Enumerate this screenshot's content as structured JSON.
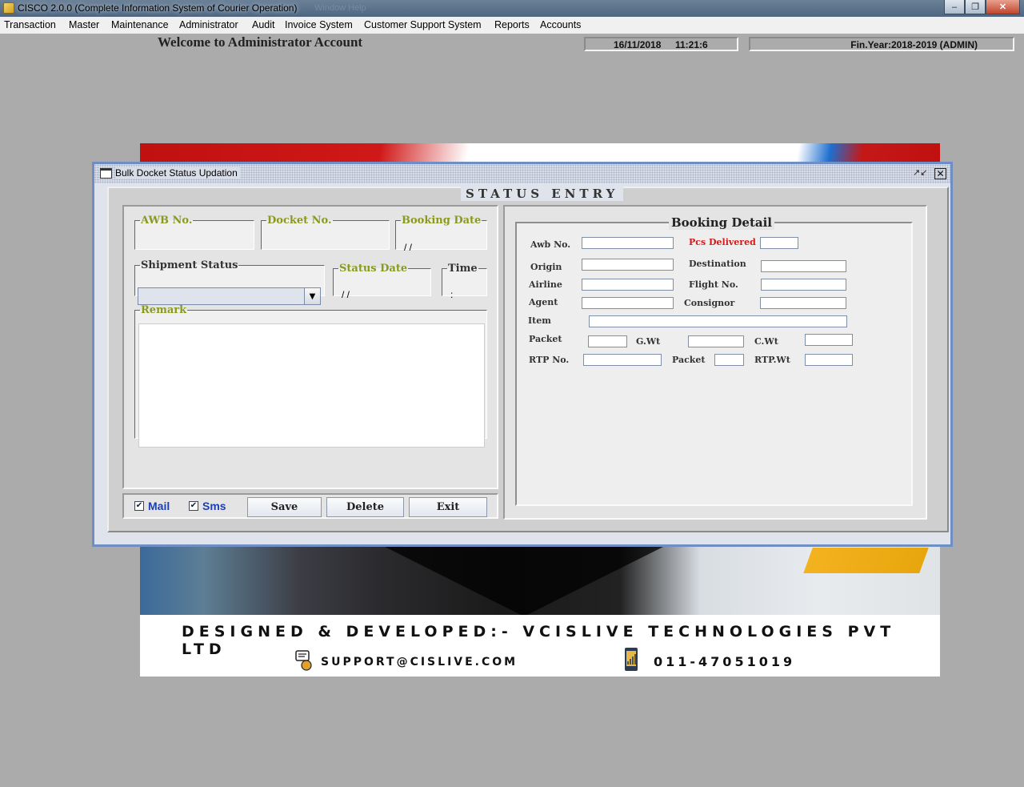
{
  "app": {
    "title": "CISCO 2.0.0 (Complete Information System of Courier Operation)",
    "ghost_menu": "Window    Help"
  },
  "menu": [
    "Transaction",
    "Master",
    "Maintenance",
    "Administrator",
    "Audit",
    "Invoice System",
    "Customer Support System",
    "Reports",
    "Accounts"
  ],
  "header": {
    "welcome": "Welcome to Administrator Account",
    "date": "16/11/2018",
    "time": "11:21:6",
    "fin_year": "Fin.Year:2018-2019  (ADMIN)"
  },
  "banner": {
    "developed_by": "DESIGNED & DEVELOPED:- VCISLIVE TECHNOLOGIES PVT LTD",
    "email": "SUPPORT@CISLIVE.COM",
    "phone": "011-47051019"
  },
  "dialog": {
    "title": "Bulk Docket Status Updation",
    "section_title": "STATUS ENTRY",
    "fields": {
      "awb_label": "AWB No.",
      "docket_label": "Docket No.",
      "booking_date_label": "Booking Date",
      "booking_date_value": "/  /",
      "shipment_status_label": "Shipment Status",
      "shipment_status_value": "",
      "status_date_label": "Status Date",
      "status_date_value": "/  /",
      "time_label": "Time",
      "time_value": ":",
      "remark_label": "Remark",
      "remark_value": ""
    },
    "bottom": {
      "mail_label": "Mail",
      "mail_checked": true,
      "sms_label": "Sms",
      "sms_checked": true,
      "save": "Save",
      "delete": "Delete",
      "exit": "Exit"
    },
    "booking_detail": {
      "title": "Booking Detail",
      "awb_no": "Awb No.",
      "pcs_delivered": "Pcs Delivered",
      "origin": "Origin",
      "destination": "Destination",
      "airline": "Airline",
      "flight_no": "Flight No.",
      "agent": "Agent",
      "consignor": "Consignor",
      "item": "Item",
      "packet": "Packet",
      "gwt": "G.Wt",
      "cwt": "C.Wt",
      "rtp_no": "RTP No.",
      "packet2": "Packet",
      "rtp_wt": "RTP.Wt"
    }
  },
  "colors": {
    "dialog_border": "#6f8ec4",
    "legend_olive": "#8a9a1c",
    "pcs_red": "#d21a1a",
    "checkbox_blue": "#1d3fae"
  }
}
